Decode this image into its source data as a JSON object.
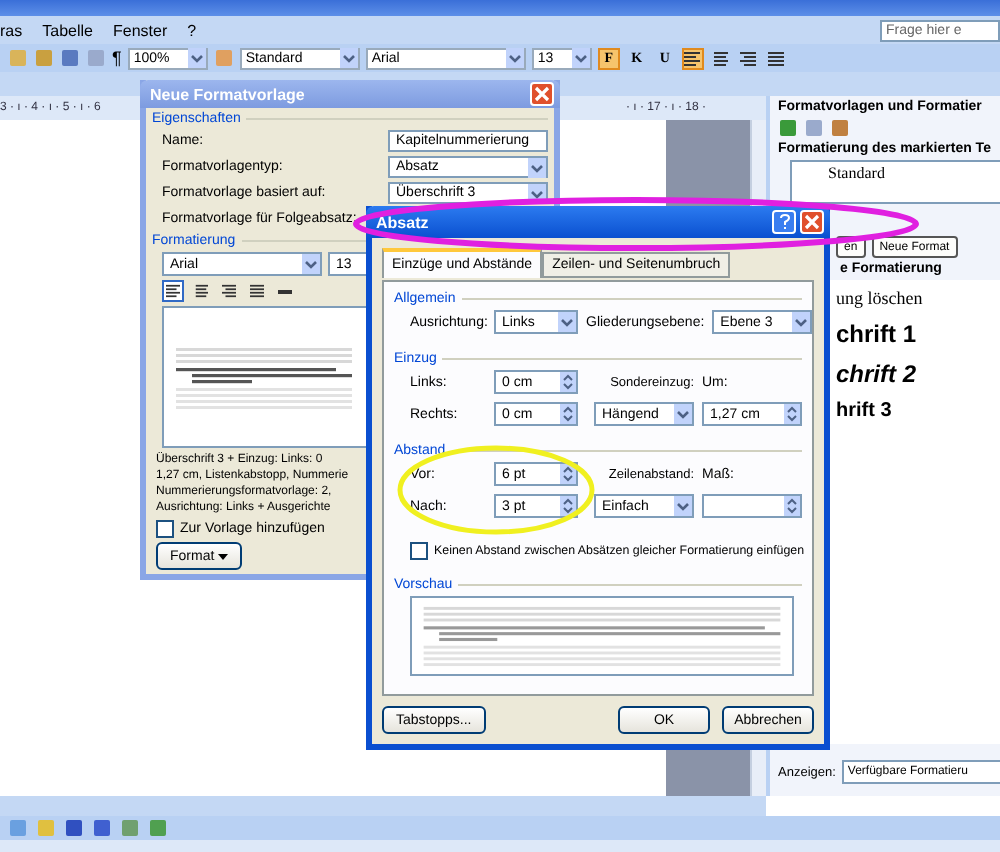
{
  "menu_bar": {
    "items": [
      "ras",
      "Tabelle",
      "Fenster",
      "?"
    ],
    "help_search": {
      "placeholder": "Frage hier e"
    }
  },
  "toolbar": {
    "pilcrow": "¶",
    "zoom": "100%",
    "style": "Standard",
    "font": "Arial",
    "size": "13",
    "format_buttons": [
      {
        "label": "F",
        "selected": true
      },
      {
        "label": "K",
        "selected": false
      },
      {
        "label": "U",
        "selected": false
      }
    ],
    "align_buttons": [
      {
        "selected": true
      },
      {
        "selected": false
      },
      {
        "selected": false
      },
      {
        "selected": false
      }
    ]
  },
  "ruler": {
    "left_marks": "3 · ı · 4 · ı · 5 · ı · 6",
    "right_marks": "· ı · 17 · ı · 18 ·"
  },
  "task_pane": {
    "title": "Formatvorlagen und Formatier",
    "section_label": "Formatierung des markierten Te",
    "current_style": "Standard",
    "buttons": [
      "en",
      "Neue Format"
    ],
    "section_label_2": "e Formatierung",
    "styles": [
      {
        "label": "ung löschen",
        "kind": "clear"
      },
      {
        "label": "chrift 1",
        "kind": "heading1"
      },
      {
        "label": "chrift 2",
        "kind": "heading2"
      },
      {
        "label": "hrift 3",
        "kind": "heading3"
      }
    ],
    "show_label": "Anzeigen:",
    "show_value": "Verfügbare Formatieru"
  },
  "new_style_dialog": {
    "title": "Neue Formatvorlage",
    "properties_label": "Eigenschaften",
    "fields": [
      {
        "label": "Name:",
        "value": "Kapitelnummerierung",
        "kind": "text"
      },
      {
        "label": "Formatvorlagentyp:",
        "value": "Absatz",
        "kind": "select"
      },
      {
        "label": "Formatvorlage basiert auf:",
        "value": "Überschrift 3",
        "kind": "select"
      },
      {
        "label": "Formatvorlage für Folgeabsatz:",
        "kind": "select"
      }
    ],
    "formatting_label": "Formatierung",
    "font": "Arial",
    "size": "13",
    "align_buttons": [
      {
        "selected": true
      },
      {
        "selected": false
      },
      {
        "selected": false
      },
      {
        "selected": false
      }
    ],
    "description": [
      "Überschrift 3 + Einzug: Links:  0",
      "1,27 cm, Listenkabstopp, Nummerie",
      "Nummerierungsformatvorlage:  2,",
      "Ausrichtung: Links + Ausgerichte"
    ],
    "add_to_template": {
      "label": "Zur Vorlage hinzufügen",
      "checked": false
    },
    "format_button": "Format"
  },
  "paragraph_dialog": {
    "title": "Absatz",
    "tabs": [
      {
        "label": "Einzüge und Abstände",
        "selected": true
      },
      {
        "label": "Zeilen- und Seitenumbruch",
        "selected": false
      }
    ],
    "general": {
      "label": "Allgemein",
      "alignment_label": "Ausrichtung:",
      "alignment": "Links",
      "outline_label": "Gliederungsebene:",
      "outline": "Ebene 3"
    },
    "indent": {
      "label": "Einzug",
      "left_label": "Links:",
      "left": "0 cm",
      "right_label": "Rechts:",
      "right": "0 cm",
      "special_label": "Sondereinzug:",
      "special": "Hängend",
      "by_label": "Um:",
      "by": "1,27 cm"
    },
    "spacing": {
      "label": "Abstand",
      "before_label": "Vor:",
      "before": "6 pt",
      "after_label": "Nach:",
      "after": "3 pt",
      "line_label": "Zeilenabstand:",
      "line": "Einfach",
      "at_label": "Maß:"
    },
    "no_space": {
      "label": "Keinen Abstand zwischen Absätzen gleicher Formatierung einfügen",
      "checked": false
    },
    "preview_label": "Vorschau",
    "buttons": [
      "Tabstopps...",
      "OK",
      "Abbrechen"
    ]
  },
  "annotations": [
    {
      "kind": "ellipse",
      "color": "#e020e0"
    },
    {
      "kind": "ellipse",
      "color": "#f0f020"
    }
  ]
}
